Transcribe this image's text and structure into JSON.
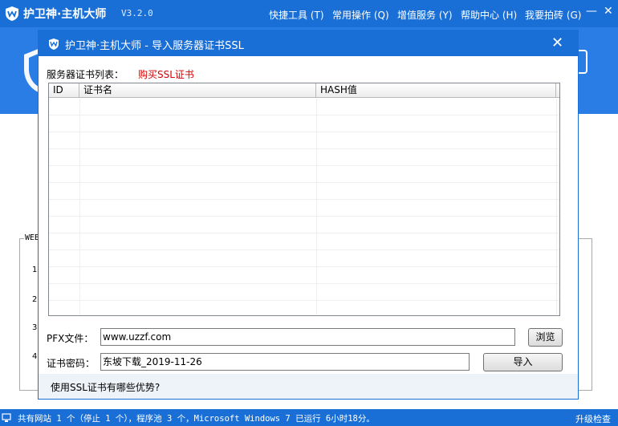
{
  "app": {
    "title": "护卫神·主机大师",
    "version": "V3.2.0",
    "menu": [
      "快捷工具 (T)",
      "常用操作 (Q)",
      "增值服务 (Y)",
      "帮助中心 (H)",
      "我要拍砖 (G)"
    ],
    "minimize": "—",
    "close": "✕"
  },
  "background": {
    "group_label": "WEB",
    "numbers": [
      "1",
      "2",
      "3",
      "4"
    ]
  },
  "dialog": {
    "title": "护卫神·主机大师 - 导入服务器证书SSL",
    "close": "✕",
    "list_label": "服务器证书列表：",
    "buy_link": "购买SSL证书",
    "columns": [
      "ID",
      "证书名",
      "HASH值"
    ],
    "rows": [],
    "pfx_label": "PFX文件：",
    "pfx_value": "www.uzzf.com",
    "browse_button": "浏览",
    "password_label": "证书密码：",
    "password_value": "东坡下载_2019-11-26",
    "import_button": "导入",
    "advantage_link": "使用SSL证书有哪些优势?"
  },
  "status": {
    "text": "共有网站 1 个（停止 1 个），程序池 3 个，Microsoft Windows 7 已运行 6小时18分。",
    "update": "升级检查"
  },
  "colors": {
    "brand_blue": "#1a6fd6",
    "link_red": "#d40000"
  }
}
